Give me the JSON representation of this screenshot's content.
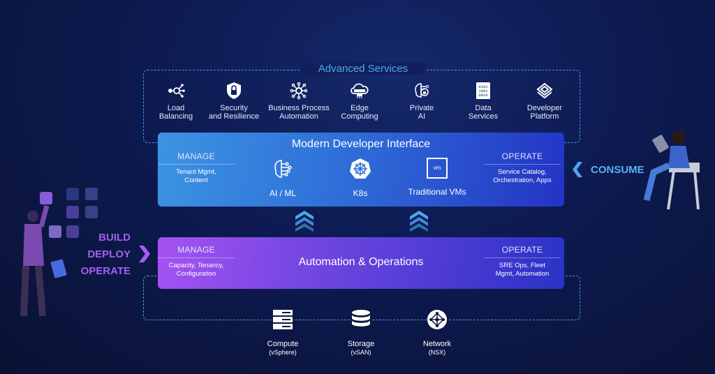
{
  "advanced_services": {
    "title": "Advanced Services",
    "items": [
      {
        "icon": "load-balancing-icon",
        "line1": "Load",
        "line2": "Balancing"
      },
      {
        "icon": "shield-lock-icon",
        "line1": "Security",
        "line2": "and Resilience"
      },
      {
        "icon": "process-network-icon",
        "line1": "Business Process",
        "line2": "Automation"
      },
      {
        "icon": "cloud-server-icon",
        "line1": "Edge",
        "line2": "Computing"
      },
      {
        "icon": "brain-lock-icon",
        "line1": "Private",
        "line2": "AI"
      },
      {
        "icon": "binary-data-icon",
        "line1": "Data",
        "line2": "Services"
      },
      {
        "icon": "layers-icon",
        "line1": "Developer",
        "line2": "Platform"
      }
    ]
  },
  "developer_interface": {
    "title": "Modern Developer Interface",
    "manage": {
      "heading": "MANAGE",
      "line1": "Tenant Mgmt,",
      "line2": "Content"
    },
    "operate": {
      "heading": "OPERATE",
      "line1": "Service Catalog,",
      "line2": "Orchestration, Apps"
    },
    "items": [
      {
        "icon": "brain-circuit-icon",
        "label": "AI / ML"
      },
      {
        "icon": "kubernetes-icon",
        "label": "K8s"
      },
      {
        "icon": "vm-icon",
        "label": "Traditional VMs",
        "glyph": "vm"
      }
    ]
  },
  "automation": {
    "title": "Automation & Operations",
    "manage": {
      "heading": "MANAGE",
      "line1": "Capacity, Tenancy,",
      "line2": "Configuration"
    },
    "operate": {
      "heading": "OPERATE",
      "line1": "SRE Ops, Fleet",
      "line2": "Mgmt, Automation"
    }
  },
  "infrastructure": [
    {
      "icon": "server-icon",
      "label": "Compute",
      "sub": "(vSphere)"
    },
    {
      "icon": "database-icon",
      "label": "Storage",
      "sub": "(vSAN)"
    },
    {
      "icon": "network-icon",
      "label": "Network",
      "sub": "(NSX)"
    }
  ],
  "left_labels": [
    "BUILD",
    "DEPLOY",
    "OPERATE"
  ],
  "right_label": "CONSUME",
  "colors": {
    "accent_blue": "#4aa8f0",
    "accent_purple": "#a35ff2",
    "background": "#0d1a50"
  }
}
